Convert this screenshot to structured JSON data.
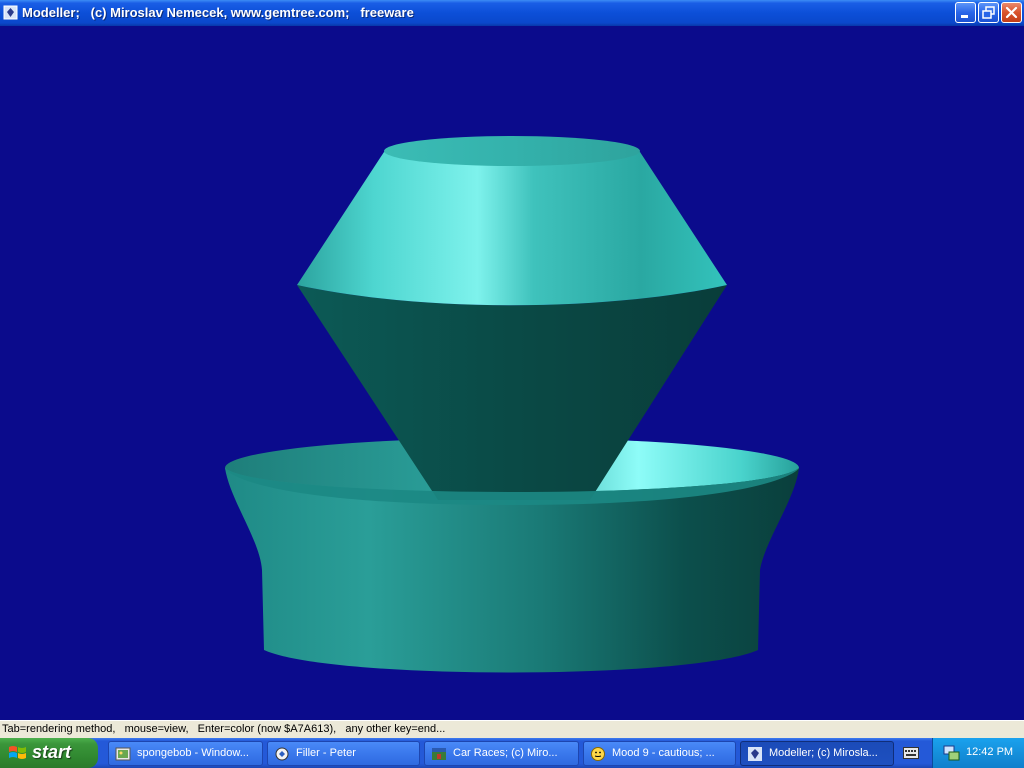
{
  "window": {
    "title": "Modeller;   (c) Miroslav Nemecek, www.gemtree.com;   freeware",
    "background_color": "#0b0b8c",
    "buttons": [
      "minimize",
      "maximize",
      "close"
    ]
  },
  "scene": {
    "object_color": "#2aa8a0"
  },
  "status": {
    "text": "Tab=rendering method,   mouse=view,   Enter=color (now $A7A613),   any other key=end..."
  },
  "taskbar": {
    "start_label": "start",
    "tasks": [
      {
        "label": "spongebob - Window...",
        "icon": "image-icon"
      },
      {
        "label": "Filler - Peter",
        "icon": "filler-icon"
      },
      {
        "label": "Car Races;  (c) Miro...",
        "icon": "car-races-icon"
      },
      {
        "label": "Mood 9 - cautious;  ...",
        "icon": "smiley-icon"
      },
      {
        "label": "Modeller;  (c) Mirosla...",
        "icon": "modeller-icon"
      }
    ],
    "clock": "12:42 PM"
  }
}
